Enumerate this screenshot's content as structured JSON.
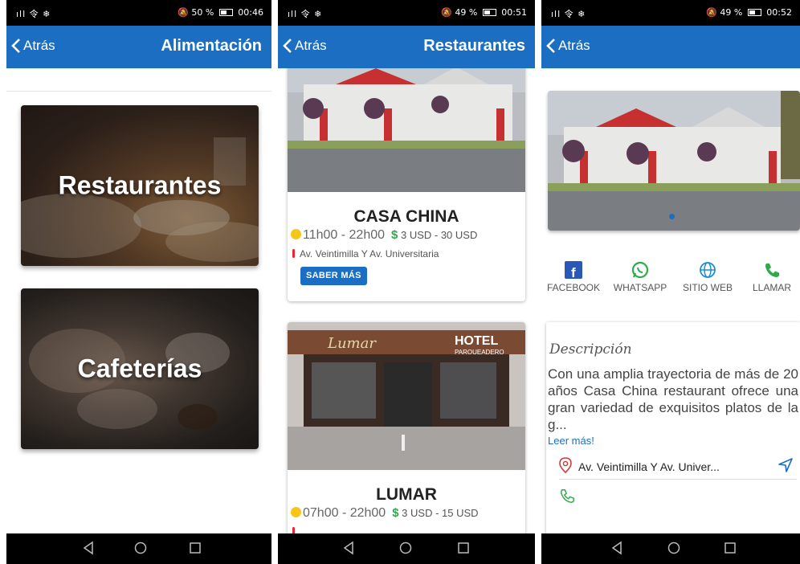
{
  "screens": [
    {
      "status": {
        "signal": "ıll 令 ❄",
        "battery": "50 %",
        "time": "00:46"
      },
      "back_label": "Atrás",
      "title": "Alimentación",
      "categories": [
        {
          "label": "Restaurantes"
        },
        {
          "label": "Cafeterías"
        }
      ]
    },
    {
      "status": {
        "signal": "ıll 令 ❄",
        "battery": "49 %",
        "time": "00:51"
      },
      "back_label": "Atrás",
      "title": "Restaurantes",
      "restaurants": [
        {
          "name": "CASA CHINA",
          "hours": "11h00 - 22h00",
          "price": "3 USD - 30 USD",
          "address": "Av. Veintimilla Y Av. Universitaria",
          "button": "SABER MÁS"
        },
        {
          "name": "LUMAR",
          "hours": "07h00 - 22h00",
          "price": "3 USD - 15 USD",
          "address": ""
        }
      ],
      "lumar_signs": {
        "left": "Lumar",
        "hotel": "HOTEL",
        "parking": "PARQUEADERO"
      }
    },
    {
      "status": {
        "signal": "ıll 令 ❄",
        "battery": "49 %",
        "time": "00:52"
      },
      "back_label": "Atrás",
      "actions": [
        {
          "label": "FACEBOOK",
          "icon": "facebook-icon"
        },
        {
          "label": "WHATSAPP",
          "icon": "whatsapp-icon"
        },
        {
          "label": "SITIO WEB",
          "icon": "globe-icon"
        },
        {
          "label": "LLAMAR",
          "icon": "phone-icon"
        }
      ],
      "description": {
        "title": "Descripción",
        "text": "Con una amplia trayectoria de más de 20 años Casa China restaurant ofrece una gran variedad de exquisitos platos de la g...",
        "more": "Leer más!",
        "address": "Av. Veintimilla Y Av. Univer..."
      }
    }
  ],
  "colors": {
    "primary": "#1b6ec2",
    "dollar_green": "#2eaa4a",
    "alarm_yellow": "#f5c518",
    "pin_red": "#e22233"
  }
}
